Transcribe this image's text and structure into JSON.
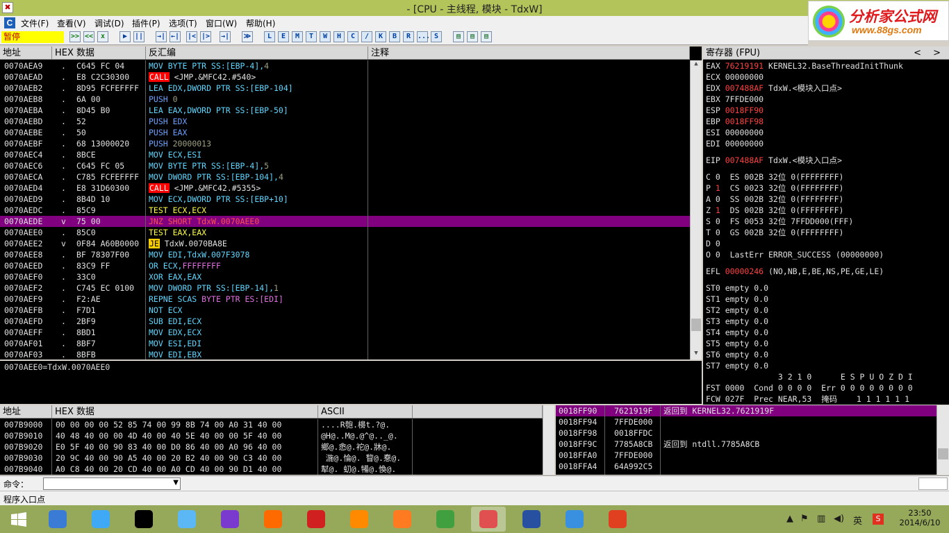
{
  "window": {
    "title": "- [CPU - 主线程, 模块 - TdxW]",
    "sys_icon": "✖"
  },
  "logo": {
    "line1": "分析家公式网",
    "line2": "www.88gs.com"
  },
  "menu": {
    "app_icon": "C",
    "items": [
      "文件(F)",
      "查看(V)",
      "调试(D)",
      "插件(P)",
      "选项(T)",
      "窗口(W)",
      "帮助(H)"
    ]
  },
  "toolbar": {
    "status": "暂停",
    "buttons": [
      ">>",
      "<<",
      "x",
      "▶",
      "||",
      "→|",
      "←|",
      "|<",
      "|>",
      "→|",
      "≫"
    ],
    "letters": [
      "L",
      "E",
      "M",
      "T",
      "W",
      "H",
      "C",
      "/",
      "K",
      "B",
      "R",
      "...",
      "S"
    ]
  },
  "disasm": {
    "headers": [
      "地址",
      "HEX 数据",
      "反汇编",
      "注释"
    ],
    "rows": [
      [
        "0070AEA9",
        ".",
        "C645 FC 04",
        [
          [
            "MOV BYTE PTR SS:[EBP-4],",
            "cy"
          ],
          [
            "4",
            "gr"
          ]
        ]
      ],
      [
        "0070AEAD",
        ".",
        "E8 C2C30300",
        [
          [
            "CALL",
            "callbox"
          ],
          [
            " <JMP.&MFC42.#540>",
            "w"
          ]
        ]
      ],
      [
        "0070AEB2",
        ".",
        "8D95 FCFEFFFF",
        [
          [
            "LEA EDX,DWORD PTR SS:[EBP-104]",
            "cy"
          ]
        ]
      ],
      [
        "0070AEB8",
        ".",
        "6A 00",
        [
          [
            "PUSH ",
            "bl"
          ],
          [
            "0",
            "gr"
          ]
        ]
      ],
      [
        "0070AEBA",
        ".",
        "8D45 B0",
        [
          [
            "LEA EAX,DWORD PTR SS:[EBP-50]",
            "cy"
          ]
        ]
      ],
      [
        "0070AEBD",
        ".",
        "52",
        [
          [
            "PUSH EDX",
            "bl"
          ]
        ]
      ],
      [
        "0070AEBE",
        ".",
        "50",
        [
          [
            "PUSH EAX",
            "bl"
          ]
        ]
      ],
      [
        "0070AEBF",
        ".",
        "68 13000020",
        [
          [
            "PUSH ",
            "bl"
          ],
          [
            "20000013",
            "gr"
          ]
        ]
      ],
      [
        "0070AEC4",
        ".",
        "8BCE",
        [
          [
            "MOV ECX,ESI",
            "cy"
          ]
        ]
      ],
      [
        "0070AEC6",
        ".",
        "C645 FC 05",
        [
          [
            "MOV BYTE PTR SS:[EBP-4],",
            "cy"
          ],
          [
            "5",
            "gr"
          ]
        ]
      ],
      [
        "0070AECA",
        ".",
        "C785 FCFEFFFF",
        [
          [
            "MOV DWORD PTR SS:[EBP-104],",
            "cy"
          ],
          [
            "4",
            "gr"
          ]
        ]
      ],
      [
        "0070AED4",
        ".",
        "E8 31D60300",
        [
          [
            "CALL",
            "callbox"
          ],
          [
            " <JMP.&MFC42.#5355>",
            "w"
          ]
        ]
      ],
      [
        "0070AED9",
        ".",
        "8B4D 10",
        [
          [
            "MOV ECX,DWORD PTR SS:[EBP+10]",
            "cy"
          ]
        ]
      ],
      [
        "0070AEDC",
        ".",
        "85C9",
        [
          [
            "TEST ECX,ECX",
            "y"
          ]
        ]
      ],
      [
        "0070AEDE",
        "v",
        "75 00",
        [
          [
            "JNZ SHORT TdxW.0070AEE0",
            "rd"
          ]
        ]
      ],
      [
        "0070AEE0",
        ".",
        "85C0",
        [
          [
            "TEST EAX,EAX",
            "y"
          ]
        ]
      ],
      [
        "0070AEE2",
        "v",
        "0F84 A60B0000",
        [
          [
            "JE",
            "jebox"
          ],
          [
            " TdxW.0070BA8E",
            "w"
          ]
        ]
      ],
      [
        "0070AEE8",
        ".",
        "BF 78307F00",
        [
          [
            "MOV EDI,TdxW.007F3078",
            "cy"
          ]
        ]
      ],
      [
        "0070AEED",
        ".",
        "83C9 FF",
        [
          [
            "OR ECX,",
            "cy"
          ],
          [
            "FFFFFFFF",
            "pk"
          ]
        ]
      ],
      [
        "0070AEF0",
        ".",
        "33C0",
        [
          [
            "XOR EAX,EAX",
            "cy"
          ]
        ]
      ],
      [
        "0070AEF2",
        ".",
        "C745 EC 0100",
        [
          [
            "MOV DWORD PTR SS:[EBP-14],",
            "cy"
          ],
          [
            "1",
            "gr"
          ]
        ]
      ],
      [
        "0070AEF9",
        ".",
        "F2:AE",
        [
          [
            "REPNE SCAS ",
            "cy"
          ],
          [
            "BYTE PTR ES:[EDI]",
            "pk"
          ]
        ]
      ],
      [
        "0070AEFB",
        ".",
        "F7D1",
        [
          [
            "NOT ECX",
            "cy"
          ]
        ]
      ],
      [
        "0070AEFD",
        ".",
        "2BF9",
        [
          [
            "SUB EDI,ECX",
            "cy"
          ]
        ]
      ],
      [
        "0070AEFF",
        ".",
        "8BD1",
        [
          [
            "MOV EDX,ECX",
            "cy"
          ]
        ]
      ],
      [
        "0070AF01",
        ".",
        "8BF7",
        [
          [
            "MOV ESI,EDI",
            "cy"
          ]
        ]
      ],
      [
        "0070AF03",
        ".",
        "8BFB",
        [
          [
            "MOV EDI,EBX",
            "cy"
          ]
        ]
      ]
    ],
    "selected_index": 14,
    "info": "0070AEE0=TdxW.0070AEE0"
  },
  "registers": {
    "header": "寄存器 (FPU)",
    "lines": [
      [
        [
          "EAX ",
          "w"
        ],
        [
          "76219191",
          "rd"
        ],
        [
          " KERNEL32.BaseThreadInitThunk",
          "w"
        ]
      ],
      [
        [
          "ECX 00000000",
          "w"
        ]
      ],
      [
        [
          "EDX ",
          "w"
        ],
        [
          "007488AF",
          "rd"
        ],
        [
          " TdxW.<模块入口点>",
          "w"
        ]
      ],
      [
        [
          "EBX 7FFDE000",
          "w"
        ]
      ],
      [
        [
          "ESP ",
          "w"
        ],
        [
          "0018FF90",
          "rd"
        ]
      ],
      [
        [
          "EBP ",
          "w"
        ],
        [
          "0018FF98",
          "rd"
        ]
      ],
      [
        [
          "ESI 00000000",
          "w"
        ]
      ],
      [
        [
          "EDI 00000000",
          "w"
        ]
      ],
      [
        [
          "",
          "w"
        ]
      ],
      [
        [
          "EIP ",
          "w"
        ],
        [
          "007488AF",
          "rd"
        ],
        [
          " TdxW.<模块入口点>",
          "w"
        ]
      ],
      [
        [
          "",
          "w"
        ]
      ],
      [
        [
          "C 0  ES 002B 32位 0(FFFFFFFF)",
          "w"
        ]
      ],
      [
        [
          "P ",
          "w"
        ],
        [
          "1",
          "rd"
        ],
        [
          "  CS 0023 32位 0(FFFFFFFF)",
          "w"
        ]
      ],
      [
        [
          "A 0  SS 002B 32位 0(FFFFFFFF)",
          "w"
        ]
      ],
      [
        [
          "Z ",
          "w"
        ],
        [
          "1",
          "rd"
        ],
        [
          "  DS 002B 32位 0(FFFFFFFF)",
          "w"
        ]
      ],
      [
        [
          "S 0  FS 0053 32位 7FFDD000(FFF)",
          "w"
        ]
      ],
      [
        [
          "T 0  GS 002B 32位 0(FFFFFFFF)",
          "w"
        ]
      ],
      [
        [
          "D 0",
          "w"
        ]
      ],
      [
        [
          "O 0  LastErr ERROR_SUCCESS (00000000)",
          "w"
        ]
      ],
      [
        [
          "",
          "w"
        ]
      ],
      [
        [
          "EFL ",
          "w"
        ],
        [
          "00000246",
          "rd"
        ],
        [
          " (NO,NB,E,BE,NS,PE,GE,LE)",
          "w"
        ]
      ],
      [
        [
          "",
          "w"
        ]
      ],
      [
        [
          "ST0 empty 0.0",
          "w"
        ]
      ],
      [
        [
          "ST1 empty 0.0",
          "w"
        ]
      ],
      [
        [
          "ST2 empty 0.0",
          "w"
        ]
      ],
      [
        [
          "ST3 empty 0.0",
          "w"
        ]
      ],
      [
        [
          "ST4 empty 0.0",
          "w"
        ]
      ],
      [
        [
          "ST5 empty 0.0",
          "w"
        ]
      ],
      [
        [
          "ST6 empty 0.0",
          "w"
        ]
      ],
      [
        [
          "ST7 empty 0.0",
          "w"
        ]
      ],
      [
        [
          "               3 2 1 0      E S P U O Z D I",
          "w"
        ]
      ],
      [
        [
          "FST 0000  Cond 0 0 0 0  Err 0 0 0 0 0 0 0 0",
          "w"
        ]
      ],
      [
        [
          "FCW 027F  Prec NEAR,53  掩码    1 1 1 1 1 1",
          "w"
        ]
      ]
    ]
  },
  "dump": {
    "headers": [
      "地址",
      "HEX 数据",
      "ASCII"
    ],
    "rows": [
      [
        "007B9000",
        "00 00 00 00 52 85 74 00 99 8B 74 00 A0 31 40 00",
        "....R匏.櫋t.?@."
      ],
      [
        "007B9010",
        "40 48 40 00 00 4D 40 00 40 5E 40 00 00 5F 40 00",
        "@H@..M@.@^@.._@."
      ],
      [
        "007B9020",
        "E0 5F 40 00 90 83 40 00 D0 86 40 00 A0 96 40 00",
        "鄉@.悆@.袉@.牀@."
      ],
      [
        "007B9030",
        "20 9C 40 00 90 A5 40 00 20 B2 40 00 90 C3 40 00",
        " 湤@.惀@. 睝@.惷@."
      ],
      [
        "007B9040",
        "A0 C8 40 00 20 CD 40 00 A0 CD 40 00 90 D1 40 00",
        "犎@. 虭@.犕@.愌@."
      ]
    ]
  },
  "stack": {
    "rows": [
      [
        "0018FF90",
        "7621919F",
        "返回到 KERNEL32.7621919F"
      ],
      [
        "0018FF94",
        "7FFDE000",
        ""
      ],
      [
        "0018FF98",
        "0018FFDC",
        ""
      ],
      [
        "0018FF9C",
        "7785A8CB",
        "返回到 ntdll.7785A8CB"
      ],
      [
        "0018FFA0",
        "7FFDE000",
        ""
      ],
      [
        "0018FFA4",
        "64A992C5",
        ""
      ]
    ],
    "selected_index": 0
  },
  "command": {
    "label": "命令：",
    "value": ""
  },
  "status_text": "程序入口点",
  "taskbar": {
    "time": "23:50",
    "date": "2014/6/10",
    "ime": "英",
    "apps": [
      [
        "#3a7bd5",
        "explorer"
      ],
      [
        "#3fa9f5",
        "baidu-cloud"
      ],
      [
        "#000000",
        "qq"
      ],
      [
        "#5bb8f5",
        "qq-browser"
      ],
      [
        "#7a3ad0",
        "abc-typing"
      ],
      [
        "#ff6a00",
        "foxmail"
      ],
      [
        "#d02020",
        "stock-app"
      ],
      [
        "#ff8a00",
        "arrow-app"
      ],
      [
        "#ff7a20",
        "fox-app"
      ],
      [
        "#40a040",
        "browser"
      ],
      [
        "#e05050",
        "ollydbg"
      ],
      [
        "#2850a0",
        "hex-editor"
      ],
      [
        "#3a90e0",
        "picture-viewer"
      ],
      [
        "#e04020",
        "office-app"
      ]
    ],
    "colors": {
      "accent": "#800080",
      "call": "#ff0000",
      "je": "#ffd000",
      "pause": "#ffff00"
    }
  }
}
